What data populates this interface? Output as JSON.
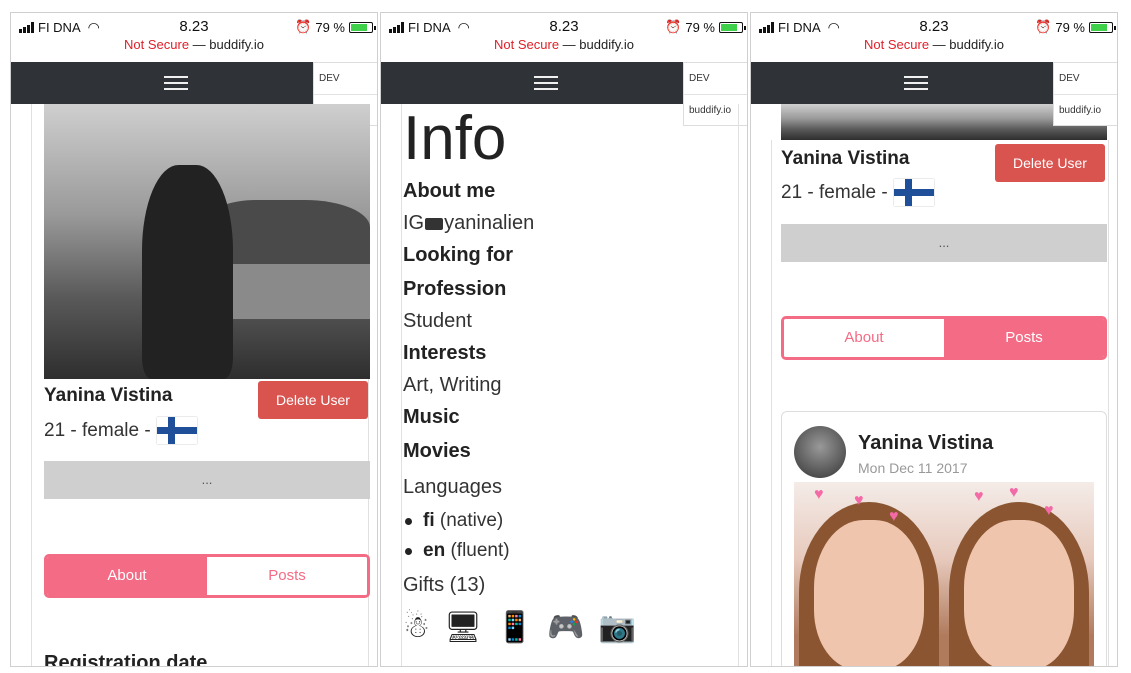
{
  "status": {
    "carrier": "FI DNA",
    "time": "8.23",
    "alarm": "⏰",
    "battery_pct": "79 %",
    "battery_level": 0.79
  },
  "url": {
    "not_secure": "Not Secure",
    "sep": " — ",
    "domain": "buddify.io"
  },
  "dropdown": {
    "items": [
      "DEV",
      "buddify.io"
    ]
  },
  "profile": {
    "name": "Yanina Vistina",
    "meta": "21 - female -",
    "delete_label": "Delete User",
    "more_label": "...",
    "tabs": {
      "about": "About",
      "posts": "Posts"
    },
    "registration_heading": "Registration date"
  },
  "info": {
    "title": "Info",
    "about_me_label": "About me",
    "about_me_prefix": "IG",
    "about_me_value": "yaninalien",
    "looking_for_label": "Looking for",
    "profession_label": "Profession",
    "profession_value": "Student",
    "interests_label": "Interests",
    "interests_value": "Art, Writing",
    "music_label": "Music",
    "movies_label": "Movies",
    "languages_label": "Languages",
    "languages": [
      {
        "code": "fi",
        "level": "(native)"
      },
      {
        "code": "en",
        "level": "(fluent)"
      }
    ],
    "gifts_label": "Gifts (13)",
    "gifts": [
      "☃",
      "🖥",
      "📱",
      "🎮",
      "📷"
    ]
  },
  "post": {
    "author": "Yanina Vistina",
    "date": "Mon Dec 11 2017"
  },
  "colors": {
    "accent": "#f46b85",
    "danger": "#d9534f",
    "navbar": "#2f3237"
  }
}
